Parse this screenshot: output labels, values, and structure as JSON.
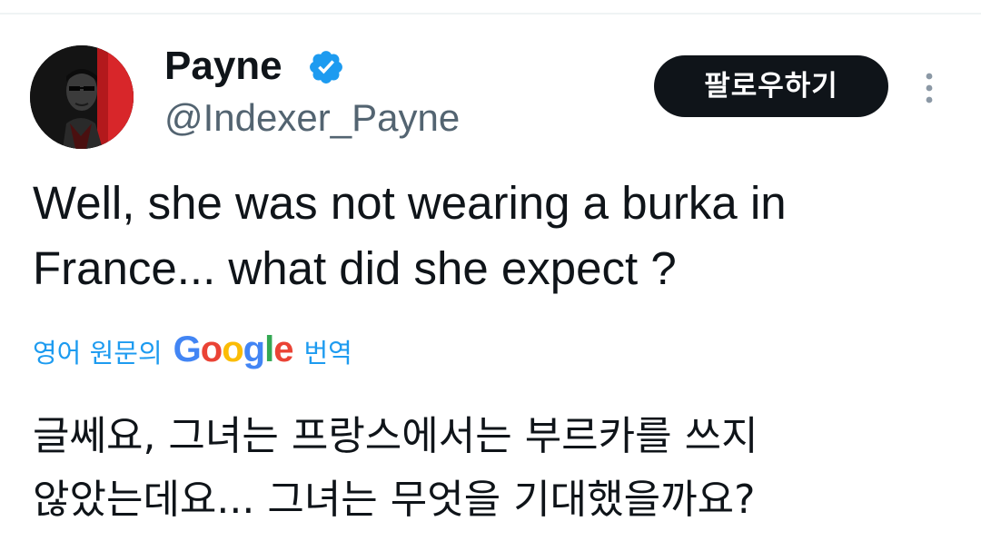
{
  "author": {
    "display_name": "Payne",
    "handle": "@Indexer_Payne",
    "verified": true
  },
  "actions": {
    "follow_label": "팔로우하기",
    "more_icon": "more-vertical-icon"
  },
  "tweet": {
    "text": "Well, she was not wearing a burka in France... what did she expect ?"
  },
  "translation": {
    "prefix": "영어 원문의",
    "service_letters": [
      "G",
      "o",
      "o",
      "g",
      "l",
      "e"
    ],
    "suffix": "번역",
    "translated_text": "글쎄요, 그녀는 프랑스에서는 부르카를 쓰지\n않았는데요... 그녀는 무엇을 기대했을까요?"
  },
  "colors": {
    "accent": "#1d9bf0",
    "text_primary": "#0f1419",
    "text_secondary": "#536471",
    "follow_bg": "#0f1419",
    "google": [
      "#4285f4",
      "#ea4335",
      "#fbbc05",
      "#4285f4",
      "#34a853",
      "#ea4335"
    ]
  }
}
